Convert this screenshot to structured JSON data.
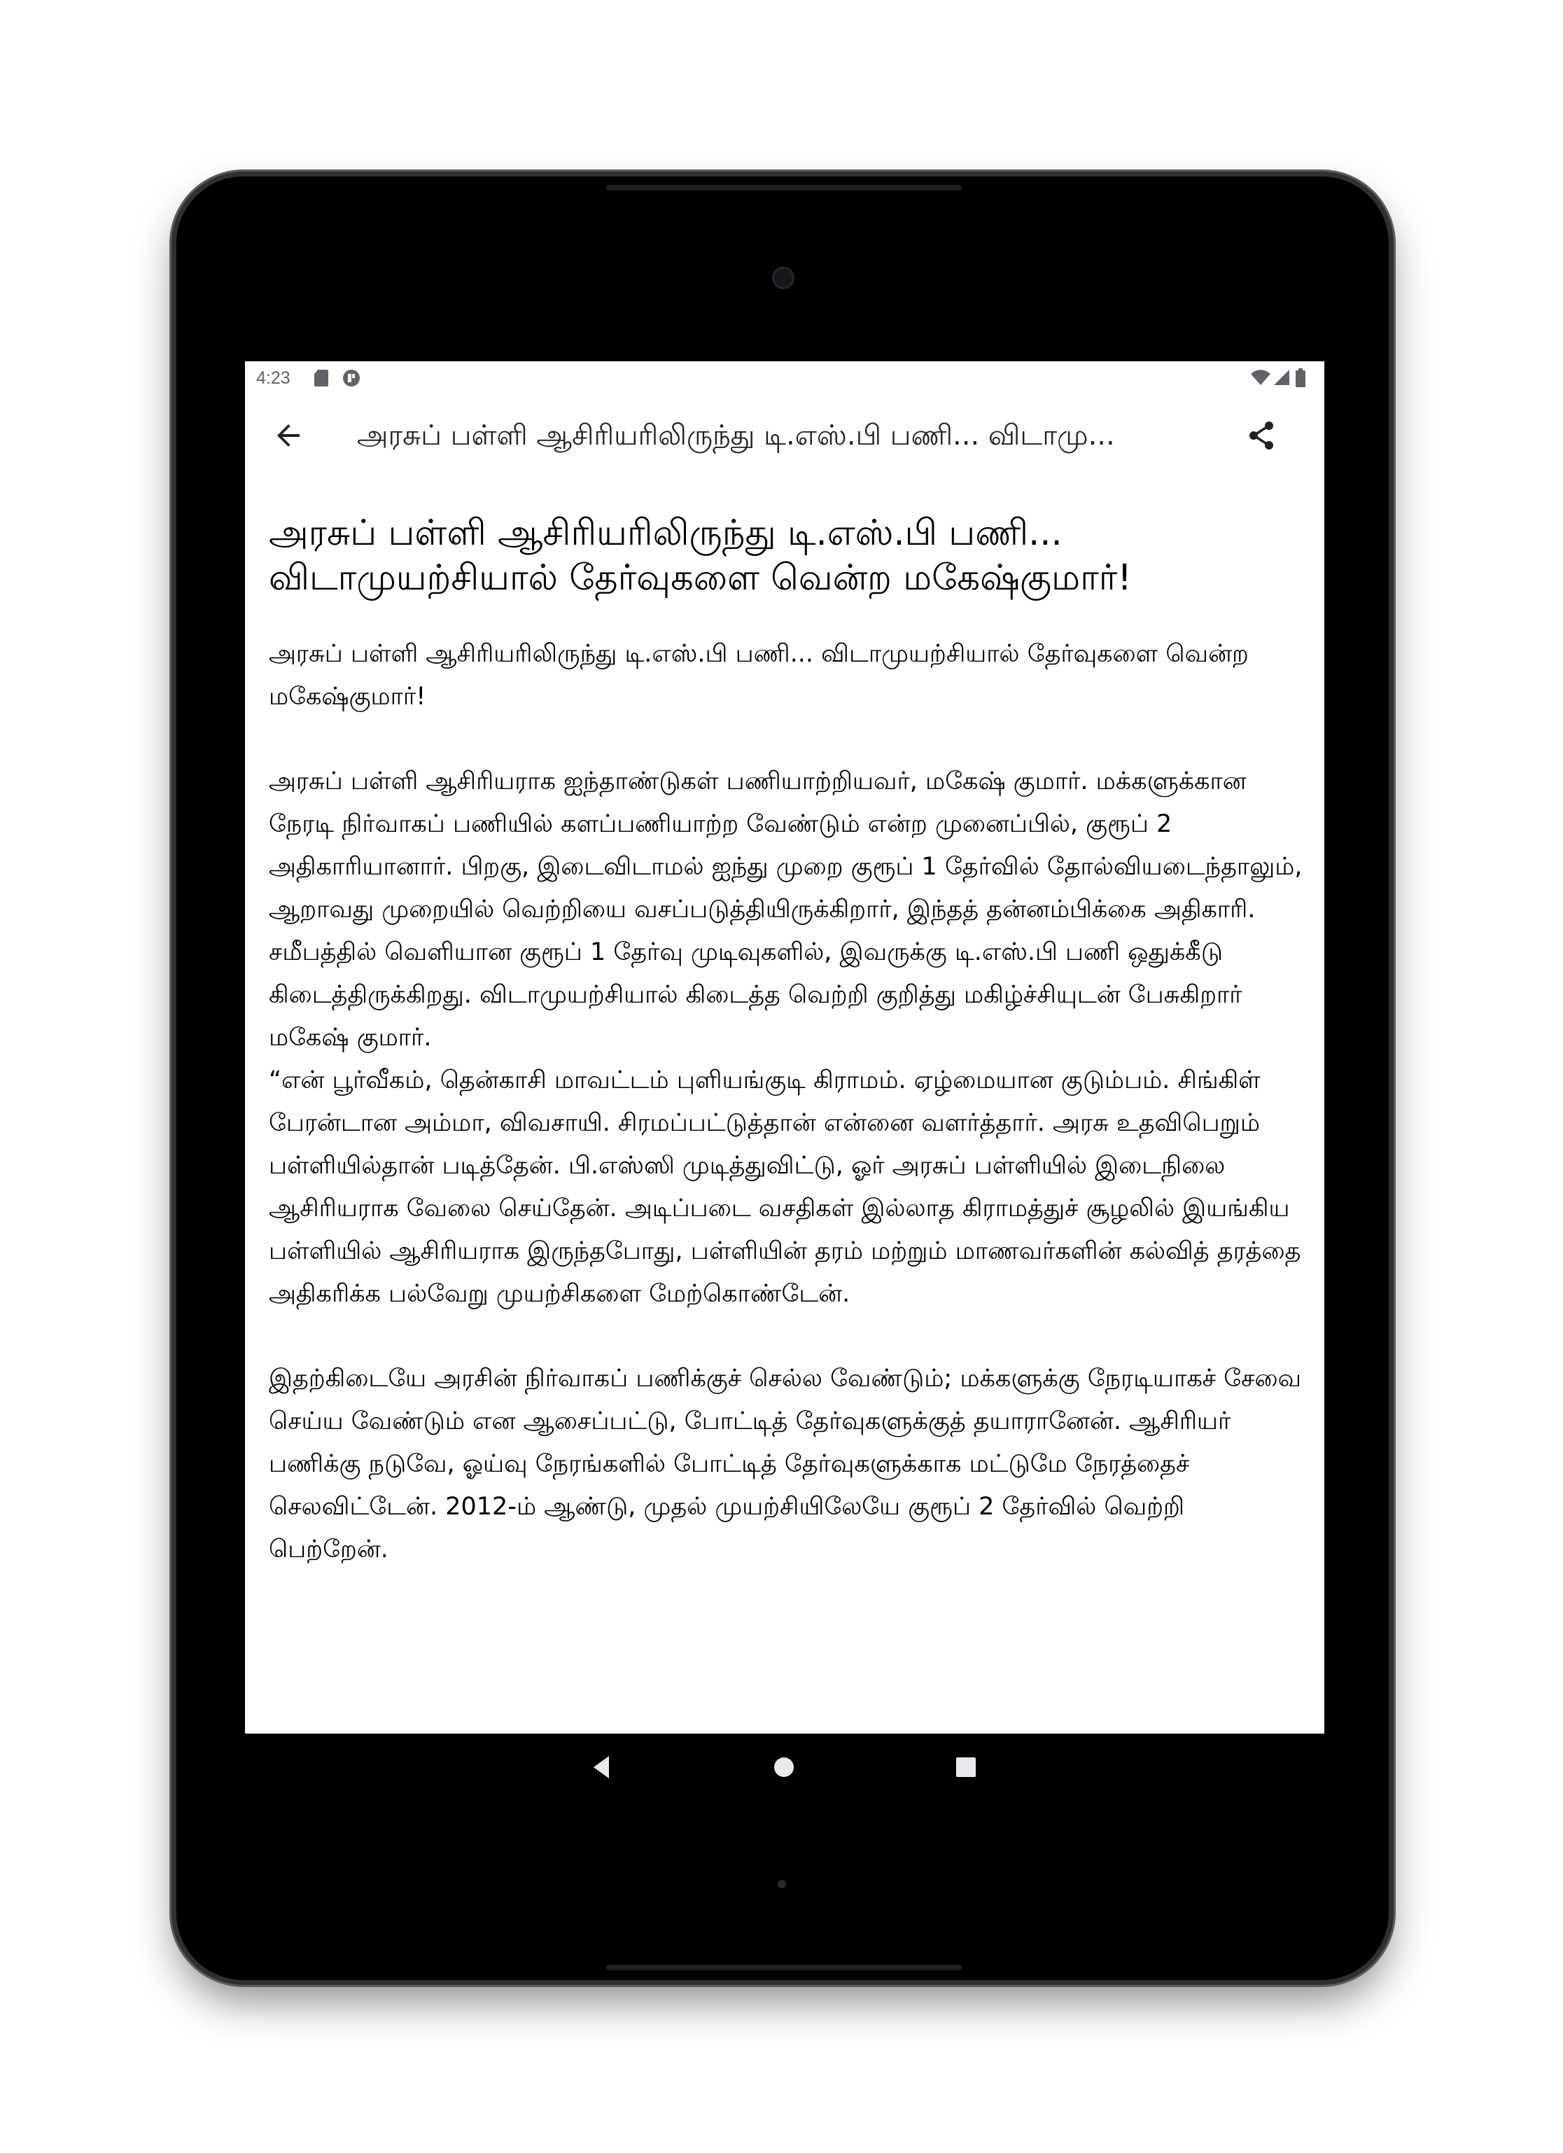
{
  "status_bar": {
    "time": "4:23",
    "left_icons": [
      "sd-card-icon",
      "app-notification-icon"
    ],
    "right_icons": [
      "wifi-icon",
      "signal-icon",
      "battery-icon"
    ]
  },
  "app_bar": {
    "title": "அரசுப் பள்ளி ஆசிரியரிலிருந்து டி.எஸ்.பி பணி... விடாமு...",
    "back_icon": "arrow-back-icon",
    "share_icon": "share-icon"
  },
  "article": {
    "headline": "அரசுப் பள்ளி ஆசிரியரிலிருந்து டி.எஸ்.பி பணி... விடாமுயற்சியால் தேர்வுகளை வென்ற மகேஷ்குமார்!",
    "paragraphs": [
      "அரசுப் பள்ளி ஆசிரியரிலிருந்து டி.எஸ்.பி பணி... விடாமுயற்சியால் தேர்வுகளை வென்ற மகேஷ்குமார்!",
      "அரசுப் பள்ளி ஆசிரியராக ஐந்தாண்டுகள் பணியாற்றியவர், மகேஷ் குமார். மக்களுக்கான நேரடி நிர்வாகப் பணியில் களப்பணியாற்ற வேண்டும் என்ற முனைப்பில், குரூப் 2 அதிகாரியானார். பிறகு, இடைவிடாமல் ஐந்து முறை குரூப் 1 தேர்வில் தோல்வியடைந்தாலும், ஆறாவது முறையில் வெற்றியை வசப்படுத்தியிருக்கிறார், இந்தத் தன்னம்பிக்கை அதிகாரி.",
      "சமீபத்தில் வெளியான குரூப் 1 தேர்வு முடிவுகளில், இவருக்கு டி.எஸ்.பி பணி ஒதுக்கீடு கிடைத்திருக்கிறது. விடாமுயற்சியால் கிடைத்த வெற்றி குறித்து மகிழ்ச்சியுடன் பேசுகிறார் மகேஷ் குமார்.",
      "“என் பூர்வீகம், தென்காசி மாவட்டம் புளியங்குடி கிராமம். ஏழ்மையான குடும்பம். சிங்கிள் பேரன்டான அம்மா, விவசாயி. சிரமப்பட்டுத்தான் என்னை வளர்த்தார். அரசு உதவிபெறும் பள்ளியில்தான் படித்தேன். பி.எஸ்ஸி முடித்துவிட்டு, ஓர் அரசுப் பள்ளியில் இடைநிலை ஆசிரியராக வேலை செய்தேன். அடிப்படை வசதிகள் இல்லாத கிராமத்துச் சூழலில் இயங்கிய பள்ளியில் ஆசிரியராக இருந்தபோது, பள்ளியின் தரம் மற்றும் மாணவர்களின் கல்வித் தரத்தை அதிகரிக்க பல்வேறு முயற்சிகளை மேற்கொண்டேன்.",
      "இதற்கிடையே அரசின் நிர்வாகப் பணிக்குச் செல்ல வேண்டும்; மக்களுக்கு நேரடியாகச் சேவை செய்ய வேண்டும் என ஆசைப்பட்டு, போட்டித் தேர்வுகளுக்குத் தயாரானேன். ஆசிரியர் பணிக்கு நடுவே, ஓய்வு நேரங்களில் போட்டித் தேர்வுகளுக்காக மட்டுமே நேரத்தைச் செலவிட்டேன். 2012-ம் ஆண்டு, முதல் முயற்சியிலேயே குரூப் 2 தேர்வில் வெற்றி பெற்றேன்."
    ]
  },
  "nav_bar": {
    "buttons": [
      "nav-back-icon",
      "nav-home-icon",
      "nav-recents-icon"
    ]
  }
}
